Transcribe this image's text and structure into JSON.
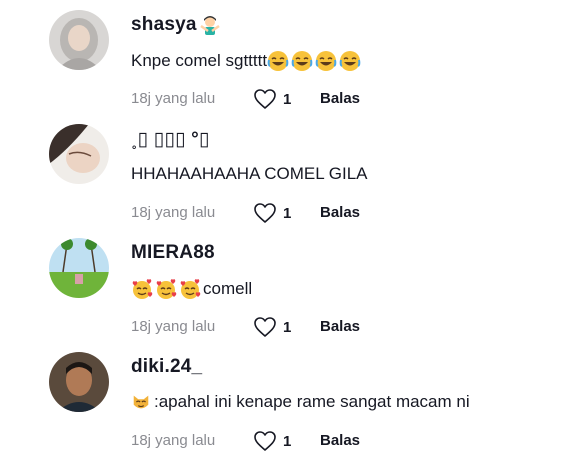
{
  "comments": [
    {
      "username": "shasya",
      "username_emoji": "person-gesturing-no-emoji",
      "text": "Knpe comel sgttttt",
      "text_emojis": [
        "face-with-tears-of-joy-emoji",
        "face-with-tears-of-joy-emoji",
        "face-with-tears-of-joy-emoji",
        "face-with-tears-of-joy-emoji"
      ],
      "time": "18j yang lalu",
      "likes": "1",
      "reply_label": "Balas"
    },
    {
      "username": "˳▯ ▯▯▯ °▯",
      "text": "HHAHAAHAAHA COMEL GILA",
      "time": "18j yang lalu",
      "likes": "1",
      "reply_label": "Balas"
    },
    {
      "username": "MIERA88",
      "text_emojis": [
        "smiling-face-with-hearts-emoji",
        "smiling-face-with-hearts-emoji",
        "smiling-face-with-hearts-emoji"
      ],
      "text": "comell",
      "time": "18j yang lalu",
      "likes": "1",
      "reply_label": "Balas"
    },
    {
      "username": "diki.24_",
      "text_emojis": [
        "cat-face-emoji"
      ],
      "text": ":apahal ini kenape rame sangat macam ni",
      "time": "18j yang lalu",
      "likes": "1",
      "reply_label": "Balas"
    }
  ],
  "colors": {
    "text": "#161823",
    "meta": "#8a8b91",
    "background": "#ffffff"
  }
}
